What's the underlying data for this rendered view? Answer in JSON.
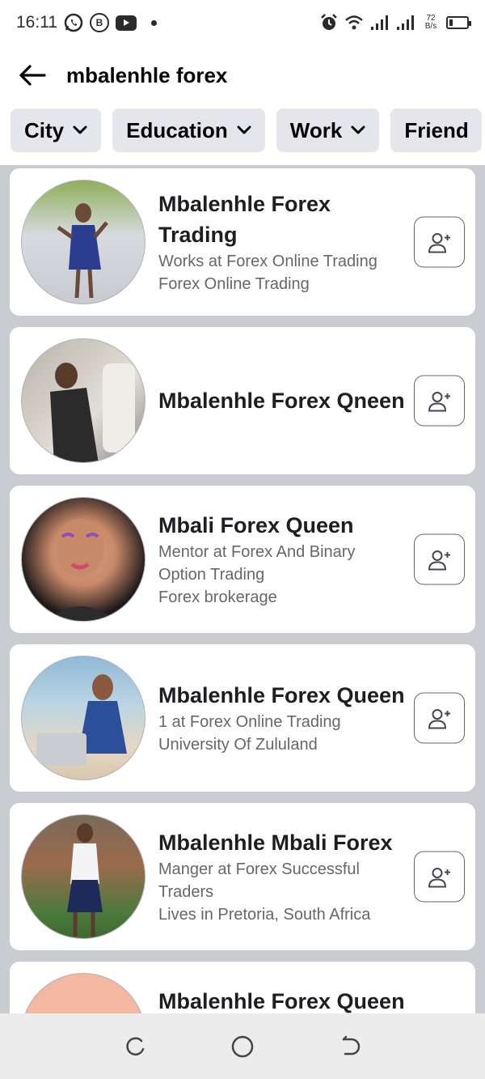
{
  "status_bar": {
    "time": "16:11",
    "net_speed_value": "72",
    "net_speed_unit": "B/s",
    "icons": [
      "whatsapp-icon",
      "b-icon",
      "youtube-icon",
      "dot-icon",
      "alarm-icon",
      "wifi-icon",
      "signal-icon",
      "signal-icon",
      "battery-icon"
    ]
  },
  "header": {
    "query": "mbalenhle forex",
    "back_icon": "back-arrow-icon"
  },
  "filters": [
    {
      "label": "City"
    },
    {
      "label": "Education"
    },
    {
      "label": "Work"
    },
    {
      "label": "Friend"
    }
  ],
  "results": [
    {
      "name_lines": [
        "Mbalenhle Forex",
        "Trading"
      ],
      "details": [
        "Works at Forex Online Trading",
        "Forex Online Trading"
      ],
      "avatar_colors": [
        "#8fae5a",
        "#c7cbd1",
        "#2a3d8f"
      ]
    },
    {
      "name_lines": [
        "Mbalenhle Forex Qneen"
      ],
      "details": [],
      "avatar_colors": [
        "#b9b3aa",
        "#e2dfd8",
        "#2b2b2b"
      ]
    },
    {
      "name_lines": [
        "Mbali Forex Queen"
      ],
      "details": [
        "Mentor at Forex And Binary",
        "Option Trading",
        "Forex brokerage"
      ],
      "avatar_colors": [
        "#1f1a1a",
        "#c98a6a",
        "#d9a07f"
      ]
    },
    {
      "name_lines": [
        "Mbalenhle Forex Queen"
      ],
      "details": [
        "1 at Forex Online Trading",
        "University Of Zululand"
      ],
      "avatar_colors": [
        "#8fbad6",
        "#e7d7c2",
        "#2c4f9a"
      ]
    },
    {
      "name_lines": [
        "Mbalenhle Mbali Forex"
      ],
      "details": [
        "Manger at Forex Successful",
        "Traders",
        "Lives in Pretoria, South Africa"
      ],
      "avatar_colors": [
        "#4b7a3c",
        "#9c6a4c",
        "#1e2a5a"
      ]
    },
    {
      "name_lines": [
        "Mbalenhle Forex Queen"
      ],
      "details": [],
      "avatar_colors": [
        "#f2b8a2",
        "#e9a58c",
        "#333333"
      ]
    }
  ],
  "nav": {
    "icons": [
      "recent-apps-icon",
      "home-circle-icon",
      "back-nav-icon"
    ]
  },
  "colors": {
    "chip_bg": "#e4e6eb",
    "list_bg": "#c9ccd1",
    "secondary_text": "#65676b",
    "nav_bg": "#ececec"
  }
}
